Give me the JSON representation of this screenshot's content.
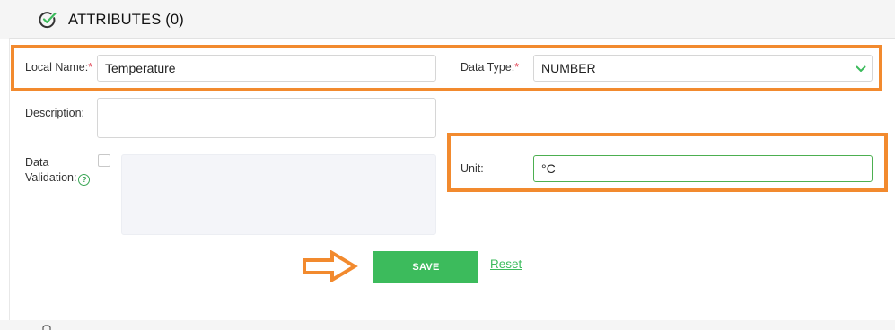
{
  "header": {
    "title": "ATTRIBUTES (0)",
    "icon": "check-circle-icon"
  },
  "form": {
    "local_name": {
      "label": "Local Name:",
      "required_mark": "*",
      "value": "Temperature"
    },
    "data_type": {
      "label": "Data Type:",
      "required_mark": "*",
      "selected": "NUMBER",
      "icon": "chevron-down-icon"
    },
    "description": {
      "label": "Description:",
      "value": ""
    },
    "data_validation": {
      "label_line1": "Data",
      "label_line2": "Validation:",
      "help_icon": "?",
      "checked": false
    },
    "unit": {
      "label": "Unit:",
      "value": "°C"
    }
  },
  "actions": {
    "save_label": "SAVE",
    "reset_label": "Reset"
  },
  "annotations": {
    "highlight_color": "#f28a2e",
    "arrow_icon": "arrow-right-icon"
  },
  "colors": {
    "accent": "#3cbb5c",
    "required": "#e0384a"
  }
}
